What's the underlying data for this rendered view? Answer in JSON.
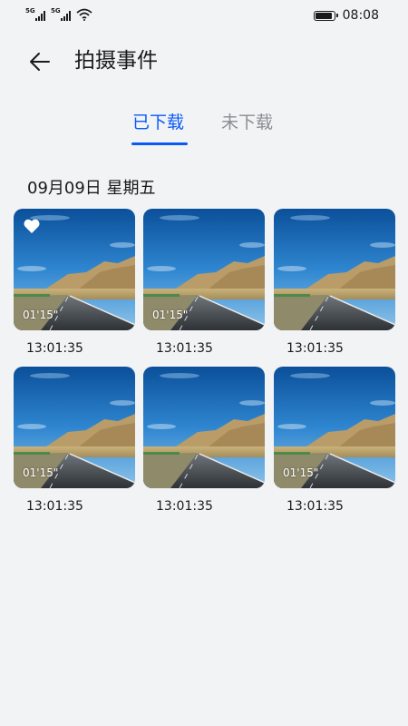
{
  "status_bar": {
    "sim1": "5G",
    "sim2": "5G",
    "time": "08:08"
  },
  "header": {
    "title": "拍摄事件",
    "back_icon": "arrow-left-icon"
  },
  "tabs": [
    {
      "label": "已下载",
      "active": true
    },
    {
      "label": "未下载",
      "active": false
    }
  ],
  "group": {
    "date": "09月09日 星期五",
    "items": [
      {
        "duration": "01'15\"",
        "time": "13:01:35",
        "favorite": true
      },
      {
        "duration": "01'15\"",
        "time": "13:01:35",
        "favorite": false
      },
      {
        "duration": "",
        "time": "13:01:35",
        "favorite": false
      },
      {
        "duration": "01'15\"",
        "time": "13:01:35",
        "favorite": false
      },
      {
        "duration": "",
        "time": "13:01:35",
        "favorite": false
      },
      {
        "duration": "01'15\"",
        "time": "13:01:35",
        "favorite": false
      }
    ]
  },
  "colors": {
    "accent": "#0a59f7",
    "inactive_tab": "#8a8c8f",
    "background": "#f1f3f5"
  }
}
